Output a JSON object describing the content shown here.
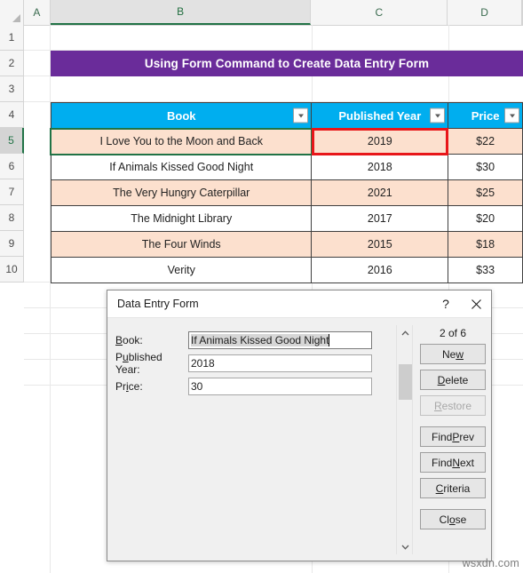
{
  "spreadsheet": {
    "column_headers": [
      "A",
      "B",
      "C",
      "D"
    ],
    "selected_column": "B",
    "row_headers": [
      "1",
      "2",
      "3",
      "4",
      "5",
      "6",
      "7",
      "8",
      "9",
      "10"
    ],
    "selected_row": "5",
    "banner_title": "Using Form Command to Create Data Entry Form",
    "banner_color": "#6A2C9A",
    "header_color": "#00AEEF",
    "alt_row_color": "#FCE0CE",
    "selection_outline_color": "#E8161A",
    "active_cell_outline_color": "#217346",
    "table": {
      "columns": [
        "Book",
        "Published Year",
        "Price"
      ],
      "rows": [
        {
          "book": "I Love You to the Moon and Back",
          "year": "2019",
          "price": "$22"
        },
        {
          "book": "If Animals Kissed Good Night",
          "year": "2018",
          "price": "$30"
        },
        {
          "book": "The Very Hungry Caterpillar",
          "year": "2021",
          "price": "$25"
        },
        {
          "book": "The Midnight Library",
          "year": "2017",
          "price": "$20"
        },
        {
          "book": "The Four Winds",
          "year": "2015",
          "price": "$18"
        },
        {
          "book": "Verity",
          "year": "2016",
          "price": "$33"
        }
      ]
    }
  },
  "dialog": {
    "title": "Data Entry Form",
    "help_label": "?",
    "close_label": "close-icon",
    "fields": [
      {
        "label_pre": "",
        "label_key": "B",
        "label_post": "ook:",
        "value": "If Animals Kissed Good Night",
        "focused": true
      },
      {
        "label_pre": "P",
        "label_key": "u",
        "label_post": "blished Year:",
        "value": "2018",
        "focused": false
      },
      {
        "label_pre": "Pr",
        "label_key": "i",
        "label_post": "ce:",
        "value": "30",
        "focused": false
      }
    ],
    "record_counter": "2 of 6",
    "buttons": [
      {
        "pre": "Ne",
        "key": "w",
        "post": "",
        "disabled": false,
        "name": "new"
      },
      {
        "pre": "",
        "key": "D",
        "post": "elete",
        "disabled": false,
        "name": "delete"
      },
      {
        "pre": "",
        "key": "R",
        "post": "estore",
        "disabled": true,
        "name": "restore"
      },
      {
        "pre": "Find ",
        "key": "P",
        "post": "rev",
        "disabled": false,
        "name": "find-prev"
      },
      {
        "pre": "Find ",
        "key": "N",
        "post": "ext",
        "disabled": false,
        "name": "find-next"
      },
      {
        "pre": "",
        "key": "C",
        "post": "riteria",
        "disabled": false,
        "name": "criteria"
      },
      {
        "pre": "Cl",
        "key": "o",
        "post": "se",
        "disabled": false,
        "name": "close"
      }
    ]
  },
  "watermark": "wsxdn.com"
}
